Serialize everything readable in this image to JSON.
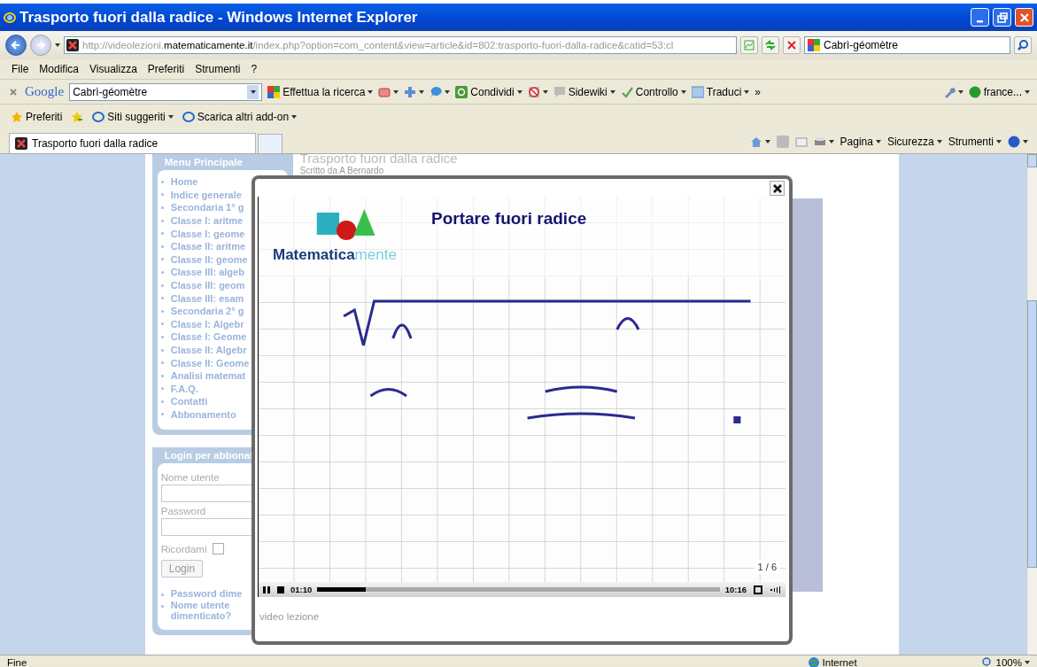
{
  "window": {
    "title": "Trasporto fuori dalla radice - Windows Internet Explorer"
  },
  "address_bar": {
    "url_prefix": "http://videolezioni.",
    "url_domain": "matematicamente.it",
    "url_rest": "/index.php?option=com_content&view=article&id=802:trasporto-fuori-dalla-radice&catid=53:cl",
    "search": "Cabrì-géomètre"
  },
  "menu_bar": [
    "File",
    "Modifica",
    "Visualizza",
    "Preferiti",
    "Strumenti",
    "?"
  ],
  "google_toolbar": {
    "logo": "Google",
    "query": "Cabrì-géomètre",
    "items": [
      {
        "kind": "search",
        "label": "Effettua la ricerca"
      },
      {
        "kind": "popup"
      },
      {
        "kind": "plus"
      },
      {
        "kind": "chat"
      },
      {
        "kind": "share",
        "label": "Condividi"
      },
      {
        "kind": "block"
      },
      {
        "kind": "sidewiki",
        "label": "Sidewiki"
      },
      {
        "kind": "spell",
        "label": "Controllo"
      },
      {
        "kind": "translate",
        "label": "Traduci"
      },
      {
        "kind": "more",
        "label": "»"
      }
    ],
    "right_items": [
      {
        "kind": "wrench"
      },
      {
        "kind": "account",
        "label": "france..."
      }
    ]
  },
  "favorites_bar": {
    "favorites": "Preferiti",
    "links": [
      {
        "label": "Siti suggeriti"
      },
      {
        "label": "Scarica altri add-on"
      }
    ]
  },
  "tabs": [
    {
      "label": "Trasporto fuori dalla radice",
      "selected": true
    }
  ],
  "command_bar": [
    "Pagina",
    "Sicurezza",
    "Strumenti"
  ],
  "sidebar": {
    "menu_title": "Menu Principale",
    "items": [
      "Home",
      "Indice generale",
      "Secondaria 1° g",
      "Classe I: aritme",
      "Classe I: geome",
      "Classe II: aritme",
      "Classe II: geome",
      "Classe III: algeb",
      "Classe III: geom",
      "Classe III: esam",
      "Secondaria 2° g",
      "Classe I: Algebr",
      "Classe I: Geome",
      "Classe II: Algebr",
      "Classe II: Geome",
      "Analisi matemat",
      "F.A.Q.",
      "Contatti",
      "Abbonamento"
    ],
    "login": {
      "title": "Login per abbonat",
      "username_label": "Nome utente",
      "password_label": "Password",
      "remember_label": "Ricordami",
      "remember": false,
      "button": "Login",
      "links": [
        "Password dime",
        "Nome utente dimenticato?"
      ]
    }
  },
  "article": {
    "title": "Trasporto fuori dalla radice",
    "byline": "Scritto da A Bernardo"
  },
  "video_player": {
    "slide_title": "Portare fuori radice",
    "logo_main": "Matematica",
    "logo_tail": "mente",
    "slide": "1 / 6",
    "elapsed": "01:10",
    "total": "10:16",
    "level": 0.12,
    "caption": "video lezione"
  },
  "status_bar": {
    "text": "Fine",
    "zone": "Internet",
    "zoom": "100%"
  }
}
